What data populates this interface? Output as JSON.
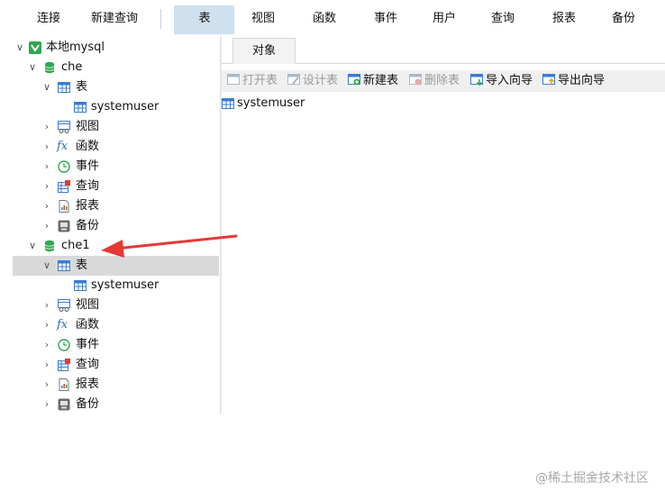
{
  "toolbar": {
    "items": [
      "连接",
      "新建查询",
      "表",
      "视图",
      "函数",
      "事件",
      "用户",
      "查询",
      "报表",
      "备份"
    ],
    "active": "表"
  },
  "tree": {
    "root": "本地mysql",
    "databases": [
      {
        "name": "che",
        "table_group": "表",
        "tables": [
          "systemuser"
        ],
        "groups": [
          "视图",
          "函数",
          "事件",
          "查询",
          "报表",
          "备份"
        ]
      },
      {
        "name": "che1",
        "table_group": "表",
        "tables": [
          "systemuser"
        ],
        "groups": [
          "视图",
          "函数",
          "事件",
          "查询",
          "报表",
          "备份"
        ]
      }
    ]
  },
  "main": {
    "tab": "对象",
    "buttons": {
      "open": "打开表",
      "design": "设计表",
      "new": "新建表",
      "delete": "删除表",
      "import": "导入向导",
      "export": "导出向导"
    },
    "objects": [
      "systemuser"
    ]
  },
  "watermark": "@稀土掘金技术社区",
  "colors": {
    "accent": "#cfe0ef",
    "selected": "#d9d9d9",
    "db_green": "#2fa84f",
    "arrow_red": "#e53935"
  }
}
